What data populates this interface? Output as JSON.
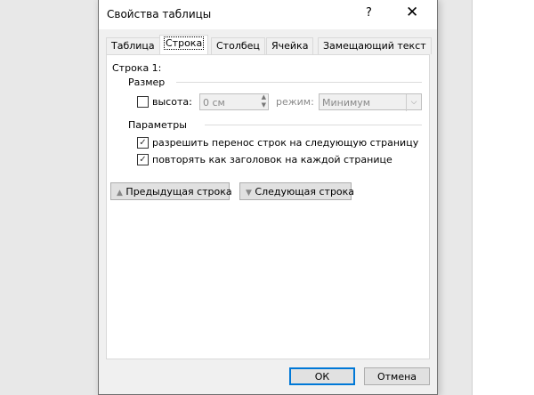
{
  "dialog": {
    "title": "Свойства таблицы",
    "help": "?",
    "close": "✕"
  },
  "tabs": [
    "Таблица",
    "Строка",
    "Столбец",
    "Ячейка",
    "Замещающий текст"
  ],
  "row": {
    "label": "Строка 1:",
    "size_group": "Размер",
    "height_label": "высота:",
    "height_value": "0 см",
    "mode_label": "режим:",
    "mode_value": "Минимум",
    "height_checked": false,
    "params_group": "Параметры",
    "allow_break": "разрешить перенос строк на следующую страницу",
    "allow_break_checked": true,
    "repeat_header": "повторять как заголовок на каждой странице",
    "repeat_header_checked": true,
    "prev": "Предыдущая строка",
    "next": "Следующая строка"
  },
  "footer": {
    "ok": "ОК",
    "cancel": "Отмена"
  }
}
